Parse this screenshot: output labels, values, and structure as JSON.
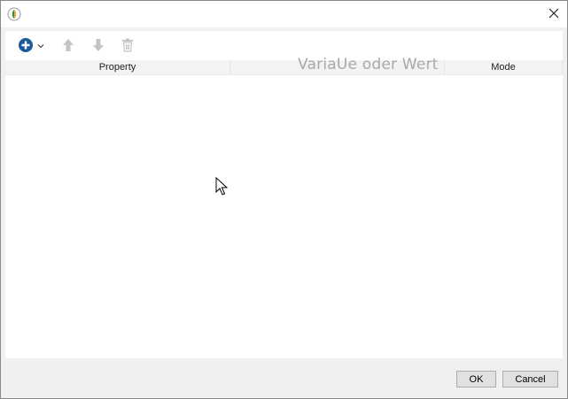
{
  "window": {
    "app_icon": "app-logo-icon",
    "close_icon": "close-icon"
  },
  "toolbar": {
    "add_icon": "plus-circle-icon",
    "add_dropdown_icon": "chevron-down-icon",
    "move_up_icon": "arrow-up-icon",
    "move_down_icon": "arrow-down-icon",
    "delete_icon": "trash-icon",
    "add_icon_color": "#1c5a9e"
  },
  "table": {
    "columns": [
      "Property",
      "",
      "Mode"
    ],
    "overlay_text": "VariaUe oder Wert",
    "rows": []
  },
  "buttons": {
    "ok_label": "OK",
    "cancel_label": "Cancel"
  }
}
